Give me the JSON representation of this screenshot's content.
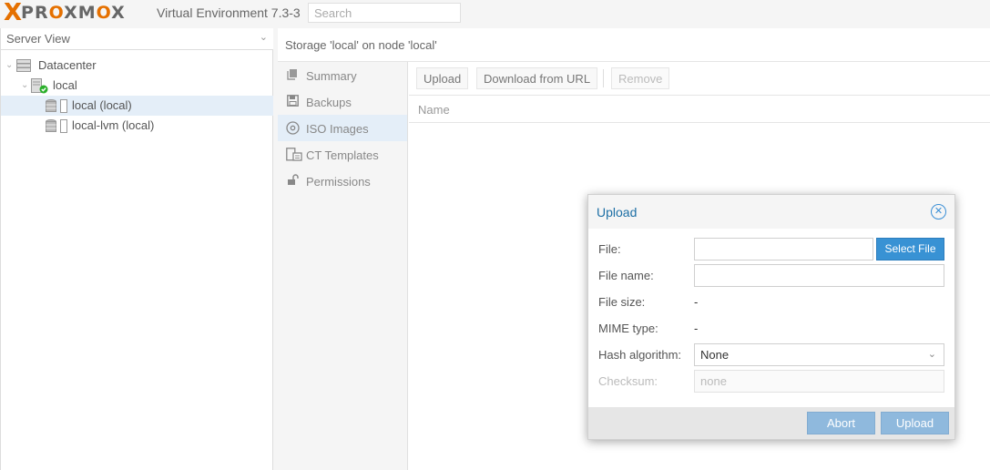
{
  "topbar": {
    "logo_x": "X",
    "logo_pro": "PR",
    "logo_o1": "O",
    "logo_xm": "XM",
    "logo_o2": "O",
    "logo_x2": "X",
    "version": "Virtual Environment 7.3-3",
    "search_placeholder": "Search"
  },
  "sidebar": {
    "view": "Server View",
    "tree": [
      {
        "label": "Datacenter",
        "icon": "datacenter-icon"
      },
      {
        "label": "local",
        "icon": "node-online-icon"
      },
      {
        "label": "local (local)",
        "icon": "storage-icon",
        "selected": true
      },
      {
        "label": "local-lvm (local)",
        "icon": "storage-icon"
      }
    ]
  },
  "content": {
    "title": "Storage 'local' on node 'local'",
    "nav": [
      {
        "label": "Summary",
        "icon": "book-icon"
      },
      {
        "label": "Backups",
        "icon": "floppy-icon"
      },
      {
        "label": "ISO Images",
        "icon": "disc-icon",
        "selected": true
      },
      {
        "label": "CT Templates",
        "icon": "template-icon"
      },
      {
        "label": "Permissions",
        "icon": "unlock-icon"
      }
    ],
    "toolbar": {
      "upload": "Upload",
      "download_url": "Download from URL",
      "remove": "Remove"
    },
    "grid": {
      "column_name": "Name"
    }
  },
  "dialog": {
    "title": "Upload",
    "file_label": "File:",
    "file_value": "",
    "select_file": "Select File",
    "filename_label": "File name:",
    "filename_value": "",
    "filesize_label": "File size:",
    "filesize_value": "-",
    "mime_label": "MIME type:",
    "mime_value": "-",
    "hash_label": "Hash algorithm:",
    "hash_value": "None",
    "checksum_label": "Checksum:",
    "checksum_placeholder": "none",
    "abort": "Abort",
    "upload": "Upload"
  },
  "colors": {
    "accent": "#3892d4",
    "brand_orange": "#e57000",
    "selection": "#e4eef8",
    "dialog_title": "#1d6fa5",
    "disabled_button": "#8fb9dd"
  }
}
